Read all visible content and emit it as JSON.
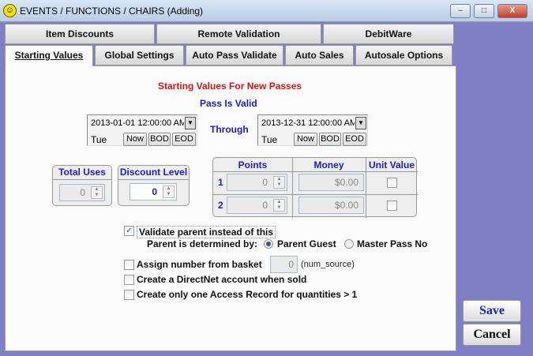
{
  "window": {
    "title": "EVENTS / FUNCTIONS / CHAIRS (Adding)",
    "minimize": "–",
    "maximize": "□",
    "close": "X"
  },
  "tabs_row1": [
    "Item Discounts",
    "Remote Validation",
    "DebitWare"
  ],
  "tabs_row2": [
    "Starting Values",
    "Global Settings",
    "Auto Pass Validate",
    "Auto Sales",
    "Autosale Options"
  ],
  "panel": {
    "heading": "Starting Values For New Passes",
    "pass_valid": "Pass Is Valid",
    "through": "Through",
    "start": {
      "value": "2013-01-01 12:00:00 AM",
      "day": "Tue"
    },
    "end": {
      "value": "2013-12-31 12:00:00 AM",
      "day": "Tue"
    },
    "now": "Now",
    "bod": "BOD",
    "eod": "EOD",
    "total_uses": {
      "label": "Total Uses",
      "value": "0"
    },
    "discount_level": {
      "label": "Discount Level",
      "value": "0"
    },
    "grid": {
      "headers": [
        "Points",
        "Money",
        "Unit Value"
      ],
      "rows": [
        {
          "n": "1",
          "points": "0",
          "money": "$0.00",
          "unit": false
        },
        {
          "n": "2",
          "points": "0",
          "money": "$0.00",
          "unit": false
        }
      ]
    },
    "validate_parent": {
      "label": "Validate parent instead of this",
      "checked": true
    },
    "parent_by": {
      "label": "Parent is determined by:",
      "options": [
        "Parent Guest",
        "Master Pass No"
      ],
      "selected": "Parent Guest"
    },
    "assign": {
      "label": "Assign number from basket",
      "value": "0",
      "note": "(num_source)",
      "checked": false
    },
    "directnet": {
      "label": "Create a DirectNet account when sold",
      "checked": false
    },
    "access": {
      "label": "Create only one Access Record for quantities > 1",
      "checked": false
    }
  },
  "buttons": {
    "save": "Save",
    "cancel": "Cancel"
  },
  "colors": {
    "background": "#7f7fc6",
    "heading": "#e01010",
    "label": "#1a1ad8"
  }
}
